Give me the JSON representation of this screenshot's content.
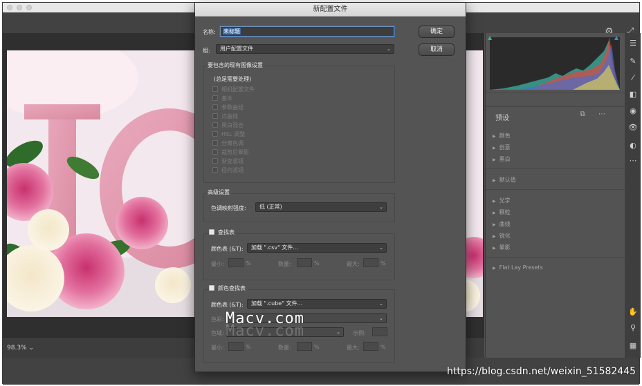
{
  "dialog": {
    "title": "新配置文件",
    "name_label": "名称:",
    "name_value": "未标题",
    "group_label": "组:",
    "group_value": "用户配置文件",
    "ok_button": "确定",
    "cancel_button": "取消",
    "existing_settings": {
      "title": "要包含的现有图像设置",
      "note": "(总是需要处理)",
      "items": [
        "相机配置文件",
        "基本",
        "参数曲线",
        "点曲线",
        "黑白混合",
        "HSL 调整",
        "分离色调",
        "裁剪后晕影",
        "渐变滤镜",
        "径向滤镜"
      ]
    },
    "advanced": {
      "title": "高级设置",
      "tone_map_label": "色调映射强度:",
      "tone_map_value": "低 (正常)"
    },
    "lookup_table": {
      "title": "查找表",
      "color_table_label": "颜色表 (&T):",
      "color_table_value": "加载 \".csv\" 文件...",
      "min_label": "最小:",
      "amount_label": "数量:",
      "max_label": "最大:",
      "pct": "%"
    },
    "color_lookup_table": {
      "title": "颜色查找表",
      "color_table_label": "颜色表 (&T):",
      "color_table_value": "加载 \".cube\" 文件...",
      "color_space_label": "色彩:",
      "gamut_label": "色域:",
      "sample_label": "示例:",
      "min_label": "最小:",
      "amount_label": "数量:",
      "max_label": "最大:",
      "pct": "%"
    }
  },
  "right_panel": {
    "presets_title": "预设",
    "preset_groups": [
      "颜色",
      "创意",
      "黑白"
    ],
    "default_group": "默认值",
    "effect_groups": [
      "光学",
      "颗粒",
      "曲线",
      "锐化",
      "晕影"
    ],
    "flat_lay": "Flat Lay Presets"
  },
  "canvas": {
    "zoom": "98.3%"
  },
  "overlay": {
    "watermark": "Macv.com",
    "url": "https://blog.csdn.net/weixin_51582445"
  },
  "colors": {
    "dialog_bg": "#545454",
    "accent": "#3b6aa7",
    "panel_bg": "#535353"
  }
}
